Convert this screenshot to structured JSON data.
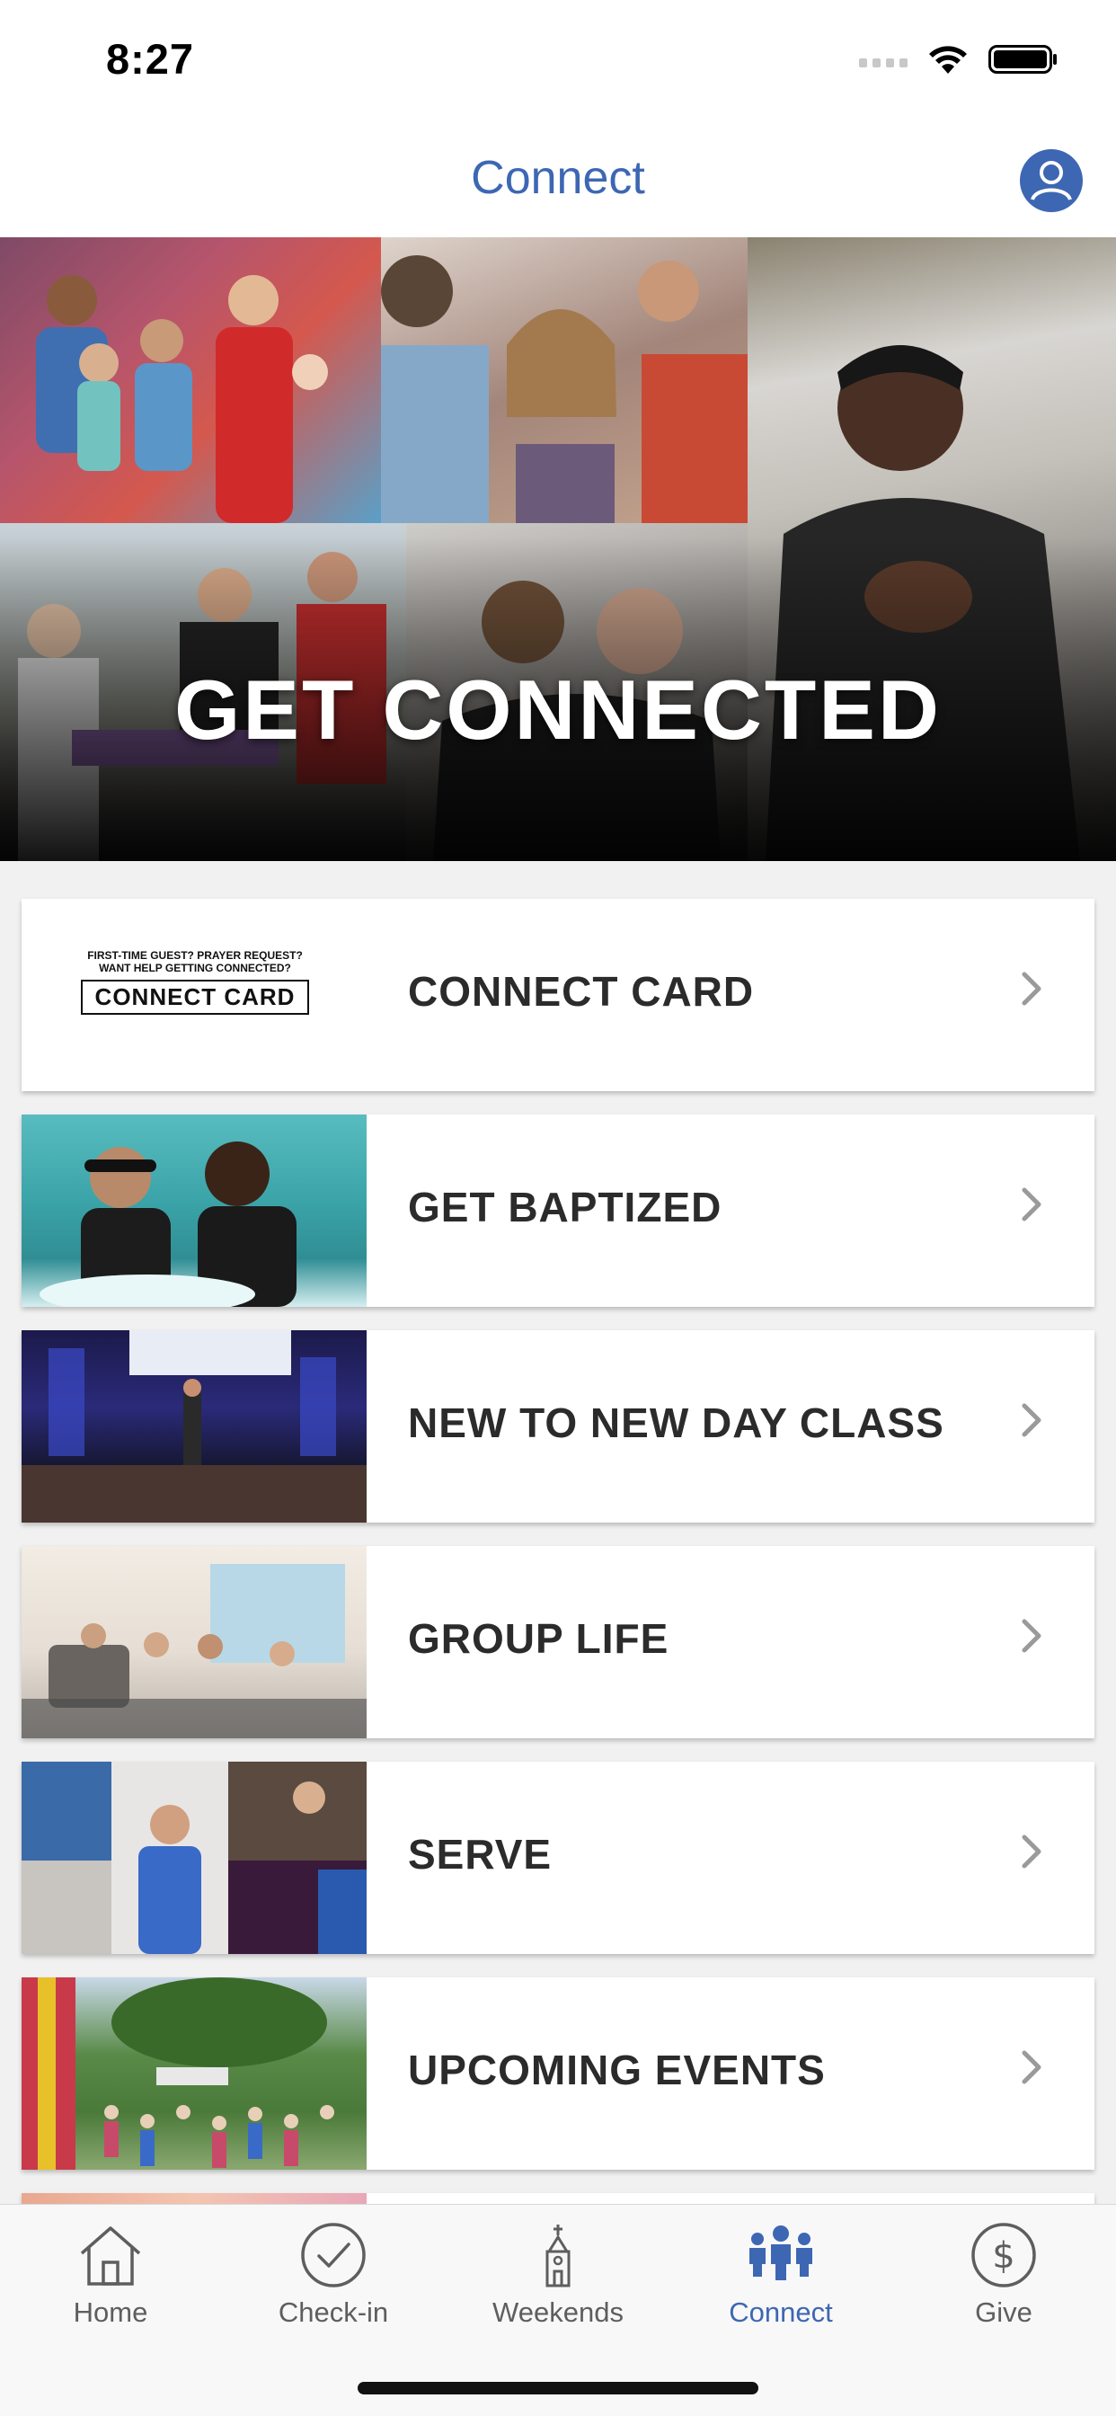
{
  "status_bar": {
    "time": "8:27"
  },
  "header": {
    "title": "Connect"
  },
  "hero": {
    "title": "GET CONNECTED"
  },
  "connect_card_logo": {
    "line1": "FIRST-TIME GUEST? PRAYER REQUEST?",
    "line2": "WANT HELP GETTING CONNECTED?",
    "box_text": "CONNECT CARD"
  },
  "cards": [
    {
      "label": "CONNECT CARD"
    },
    {
      "label": "GET BAPTIZED"
    },
    {
      "label": "NEW TO NEW DAY CLASS"
    },
    {
      "label": "GROUP LIFE"
    },
    {
      "label": "SERVE"
    },
    {
      "label": "UPCOMING EVENTS"
    }
  ],
  "tabs": [
    {
      "label": "Home",
      "icon": "house-icon"
    },
    {
      "label": "Check-in",
      "icon": "checkmark-circle-icon"
    },
    {
      "label": "Weekends",
      "icon": "church-icon"
    },
    {
      "label": "Connect",
      "icon": "people-group-icon",
      "active": true
    },
    {
      "label": "Give",
      "icon": "dollar-circle-icon"
    }
  ],
  "colors": {
    "accent": "#3d67b3",
    "tab_inactive": "#5e5e5e",
    "list_bg": "#f1f1f1"
  }
}
